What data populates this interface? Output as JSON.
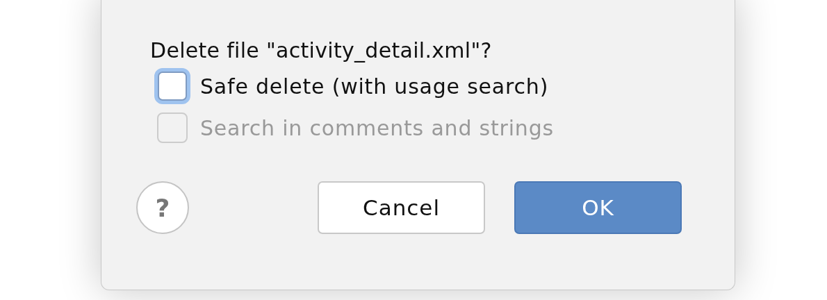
{
  "dialog": {
    "message": "Delete file \"activity_detail.xml\"?",
    "options": [
      {
        "label": "Safe delete (with usage search)",
        "checked": false,
        "focused": true,
        "disabled": false
      },
      {
        "label": "Search in comments and strings",
        "checked": false,
        "focused": false,
        "disabled": true
      }
    ],
    "help_button": "?",
    "buttons": [
      {
        "label": "Cancel",
        "kind": "secondary"
      },
      {
        "label": "OK",
        "kind": "primary"
      }
    ]
  }
}
